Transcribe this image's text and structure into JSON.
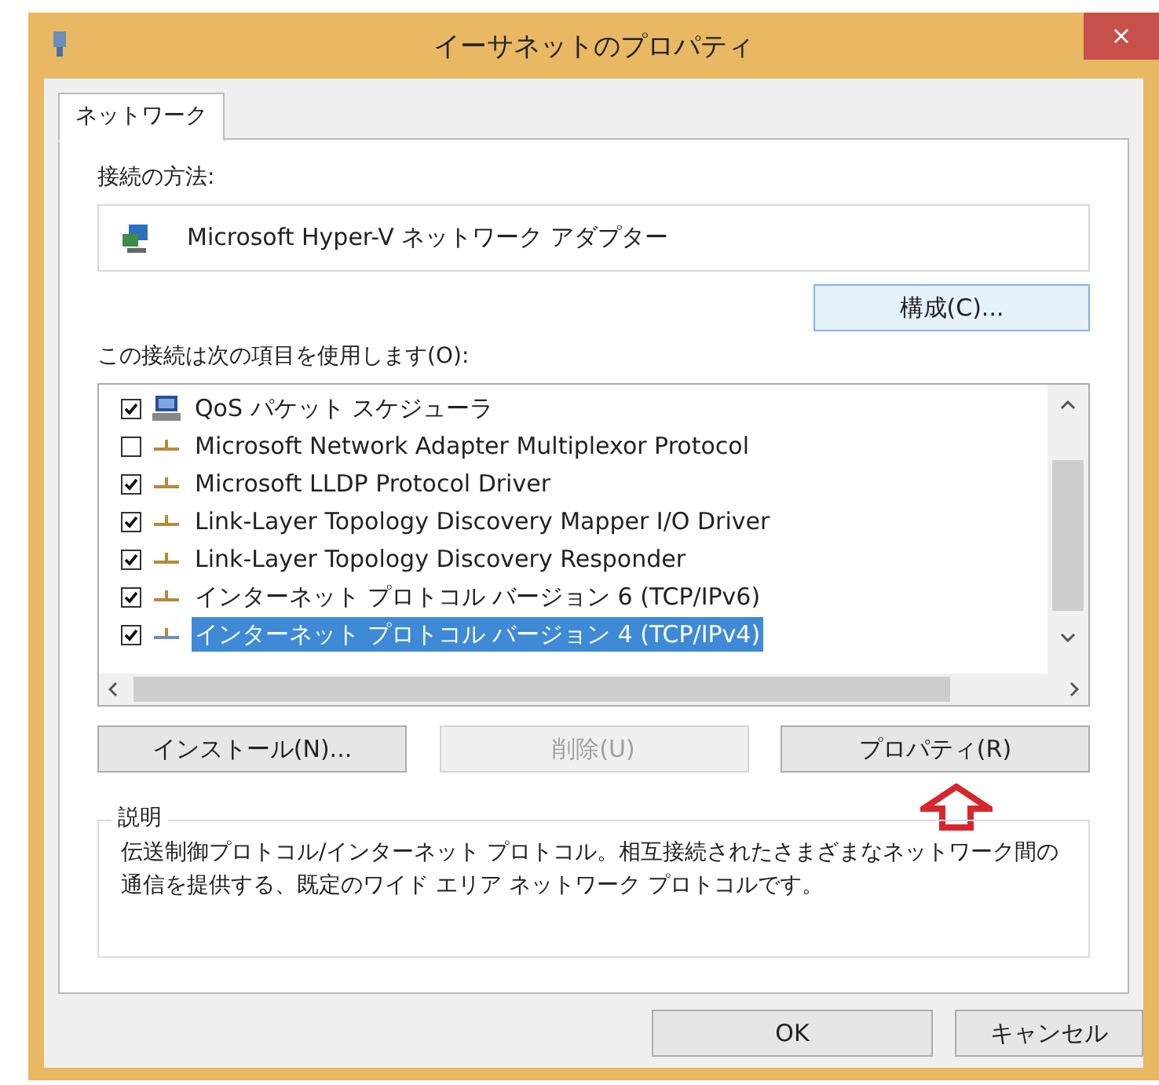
{
  "window": {
    "title": "イーサネットのプロパティ",
    "close": "×"
  },
  "tabs": [
    {
      "label": "ネットワーク",
      "selected": true
    }
  ],
  "connect_using": {
    "label": "接続の方法:",
    "adapter": "Microsoft Hyper-V ネットワーク アダプター",
    "button": "構成(C)..."
  },
  "items": {
    "label": "この接続は次の項目を使用します(O):",
    "rows": [
      {
        "kind": "scheduler",
        "label": "QoS パケット スケジューラ",
        "checked": true,
        "selected": false
      },
      {
        "kind": "protocol",
        "label": "Microsoft Network Adapter Multiplexor Protocol",
        "checked": false,
        "selected": false
      },
      {
        "kind": "protocol",
        "label": "Microsoft LLDP Protocol Driver",
        "checked": true,
        "selected": false
      },
      {
        "kind": "protocol",
        "label": "Link-Layer Topology Discovery Mapper I/O Driver",
        "checked": true,
        "selected": false
      },
      {
        "kind": "protocol",
        "label": "Link-Layer Topology Discovery Responder",
        "checked": true,
        "selected": false
      },
      {
        "kind": "protocol",
        "label": "インターネット プロトコル バージョン 6 (TCP/IPv6)",
        "checked": true,
        "selected": false
      },
      {
        "kind": "protocol",
        "label": "インターネット プロトコル バージョン 4 (TCP/IPv4)",
        "checked": true,
        "selected": true
      }
    ]
  },
  "item_buttons": [
    {
      "label": "インストール(N)...",
      "disabled": false
    },
    {
      "label": "削除(U)",
      "disabled": true
    },
    {
      "label": "プロパティ(R)",
      "disabled": false
    }
  ],
  "description": {
    "label": "説明",
    "text": "伝送制御プロトコル/インターネット プロトコル。相互接続されたさまざまなネットワーク間の通信を提供する、既定のワイド エリア ネットワーク プロトコルです。"
  },
  "dialog_buttons": [
    "OK",
    "キャンセル"
  ]
}
